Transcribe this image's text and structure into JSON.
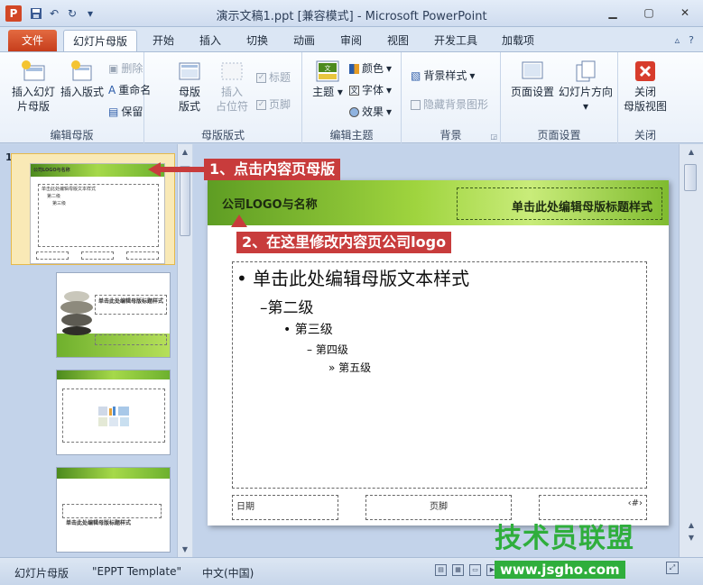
{
  "window": {
    "title": "演示文稿1.ppt [兼容模式] - Microsoft PowerPoint",
    "app_letter": "P"
  },
  "tabs": {
    "file": "文件",
    "items": [
      "幻灯片母版",
      "开始",
      "插入",
      "切换",
      "动画",
      "审阅",
      "视图",
      "开发工具",
      "加载项"
    ],
    "active": "幻灯片母版"
  },
  "ribbon": {
    "edit_master": {
      "label": "编辑母版",
      "insert_master": "插入幻灯片母版",
      "insert_master_l1": "插入幻灯",
      "insert_master_l2": "片母版",
      "insert_layout": "插入版式",
      "delete": "删除",
      "rename": "重命名",
      "preserve": "保留"
    },
    "master_layout": {
      "label": "母版版式",
      "master_layout_l1": "母版",
      "master_layout_l2": "版式",
      "insert_placeholder_l1": "插入",
      "insert_placeholder_l2": "占位符",
      "title": "标题",
      "footer": "页脚"
    },
    "edit_theme": {
      "label": "编辑主题",
      "theme": "主题",
      "colors": "颜色",
      "fonts": "字体",
      "effects": "效果"
    },
    "background": {
      "label": "背景",
      "bg_styles": "背景样式",
      "hide_bg": "隐藏背景图形"
    },
    "page_setup": {
      "label": "页面设置",
      "page_setup": "页面设置",
      "orientation": "幻灯片方向"
    },
    "close": {
      "label": "关闭",
      "close_l1": "关闭",
      "close_l2": "母版视图"
    }
  },
  "thumbnails": {
    "selected_num": "1",
    "thumb1_logo": "公司LOGO与名称",
    "thumb1_body": "单击此处编辑母版文本样式",
    "thumb1_l2": "第二级",
    "thumb1_l3": "第三级",
    "thumb2_title": "单击此处编辑母版标题样式",
    "thumb4_title": "单击此处编辑母版标题样式"
  },
  "slide": {
    "logo": "公司LOGO与名称",
    "title": "单击此处编辑母版标题样式",
    "level1": "单击此处编辑母版文本样式",
    "level2": "第二级",
    "level3": "第三级",
    "level4": "第四级",
    "level5": "第五级",
    "bullet1": "•",
    "bullet2": "–",
    "bullet3": "•",
    "bullet4": "–",
    "bullet5": "»",
    "date": "日期",
    "footer": "页脚",
    "page_num": "‹#›"
  },
  "callouts": {
    "step1": "1、点击内容页母版",
    "step2": "2、在这里修改内容页公司logo"
  },
  "status": {
    "view": "幻灯片母版",
    "theme": "\"EPPT Template\"",
    "language": "中文(中国)"
  },
  "watermark": {
    "brand": "技术员联盟",
    "url": "www.jsgho.com"
  },
  "colors": {
    "accent_file_tab": "#d24726",
    "callout_red": "#c83c3c",
    "slide_green": "#9fd43e"
  }
}
